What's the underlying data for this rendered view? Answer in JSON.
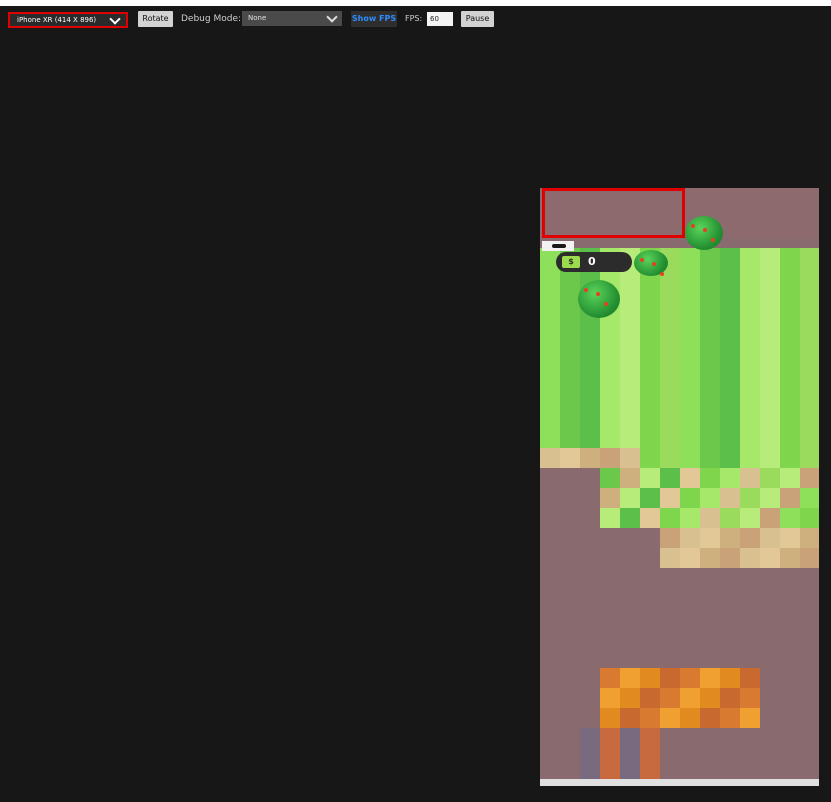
{
  "toolbar": {
    "device_select_value": "iPhone XR (414 X 896)",
    "rotate_label": "Rotate",
    "debug_mode_label": "Debug Mode:",
    "debug_select_value": "None",
    "show_fps_label": "Show FPS",
    "fps_label": "FPS:",
    "fps_value": "60",
    "pause_label": "Pause"
  },
  "game": {
    "money_value": "0",
    "money_icon_glyph": "$"
  },
  "colors": {
    "toolbar_bg": "#171717",
    "highlight": "#e00000",
    "fps_accent": "#2f8cff",
    "grass": "#8ee05a",
    "ground": "#896a6e"
  }
}
